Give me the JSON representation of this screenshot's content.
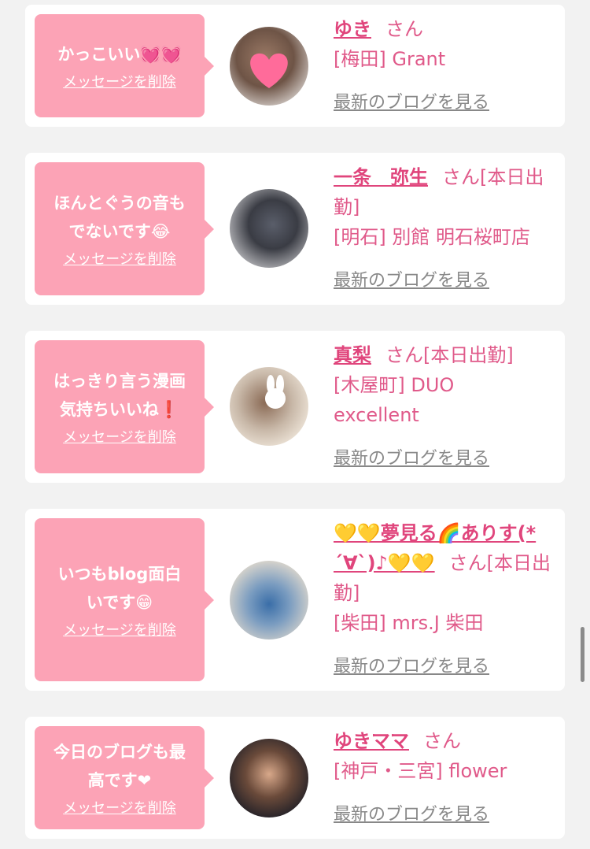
{
  "common": {
    "delete_label": "メッセージを削除",
    "blog_link_label": "最新のブログを見る",
    "honorific": "さん"
  },
  "cards": [
    {
      "message_lines": [
        "かっこいい💓💓"
      ],
      "name": "ゆき",
      "status": "",
      "shop_lines": [
        "[梅田] Grant"
      ]
    },
    {
      "message_lines": [
        "ほんとぐうの音も",
        "でないです😂"
      ],
      "name": "一条　弥生",
      "status": "[本日出勤]",
      "shop_lines": [
        "[明石] 別館 明石桜町店"
      ]
    },
    {
      "message_lines": [
        "はっきり言う漫画",
        "気持ちいいね❗"
      ],
      "name": "真梨",
      "status": "[本日出勤]",
      "shop_lines": [
        "[木屋町] DUO",
        "excellent"
      ]
    },
    {
      "message_lines": [
        "いつもblog面白",
        "いです😁"
      ],
      "name": "💛💛夢見る🌈ありす(*´∀`)♪💛💛",
      "status": "[本日出勤]",
      "shop_lines": [
        "[柴田] mrs.J 柴田"
      ]
    },
    {
      "message_lines": [
        "今日のブログも最",
        "高です❤"
      ],
      "name": "ゆきママ",
      "status": "",
      "shop_lines": [
        "[神戸・三宮] flower"
      ]
    }
  ]
}
